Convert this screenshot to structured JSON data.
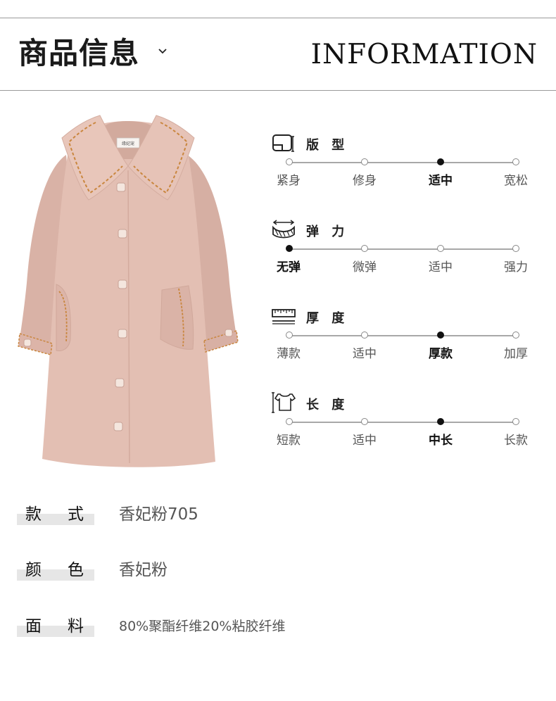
{
  "header": {
    "title_cn": "商品信息",
    "title_en": "INFORMATION"
  },
  "product_image": {
    "label_tag": "缘妃宠"
  },
  "attributes": [
    {
      "title": "版 型",
      "icon": "ruler-fabric-icon",
      "options": [
        "紧身",
        "修身",
        "适中",
        "宽松"
      ],
      "selected_index": 2
    },
    {
      "title": "弹 力",
      "icon": "stretch-fabric-icon",
      "options": [
        "无弹",
        "微弹",
        "适中",
        "强力"
      ],
      "selected_index": 0
    },
    {
      "title": "厚 度",
      "icon": "thickness-icon",
      "options": [
        "薄款",
        "适中",
        "厚款",
        "加厚"
      ],
      "selected_index": 2
    },
    {
      "title": "长 度",
      "icon": "tshirt-length-icon",
      "options": [
        "短款",
        "适中",
        "中长",
        "长款"
      ],
      "selected_index": 2
    }
  ],
  "details": [
    {
      "label_a": "款",
      "label_b": "式",
      "value": "香妃粉705"
    },
    {
      "label_a": "颜",
      "label_b": "色",
      "value": "香妃粉"
    },
    {
      "label_a": "面",
      "label_b": "料",
      "value": "80%聚酯纤维20%粘胶纤维"
    }
  ],
  "colors": {
    "coat": "#e3bfb3",
    "stitch": "#c9863e",
    "label_bar": "#e6e6e6"
  }
}
